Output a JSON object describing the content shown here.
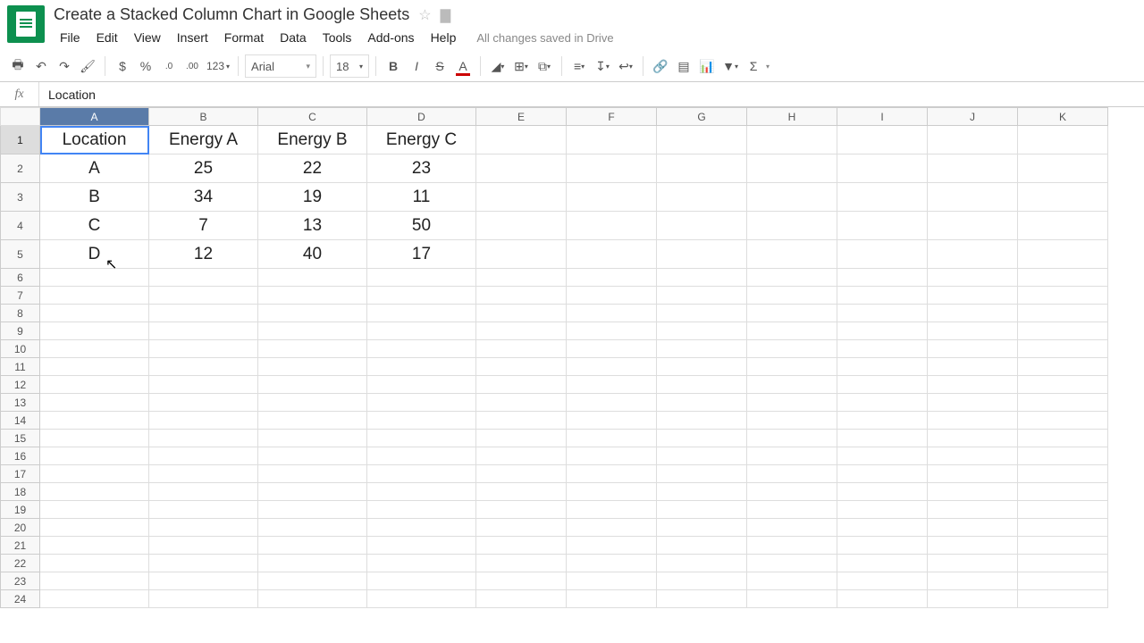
{
  "doc": {
    "title": "Create a Stacked Column Chart in Google Sheets",
    "save_status": "All changes saved in Drive"
  },
  "menu": {
    "file": "File",
    "edit": "Edit",
    "view": "View",
    "insert": "Insert",
    "format": "Format",
    "data": "Data",
    "tools": "Tools",
    "addons": "Add-ons",
    "help": "Help"
  },
  "toolbar": {
    "currency": "$",
    "percent": "%",
    "dec_dec": ".0",
    "inc_dec": ".00",
    "numfmt": "123",
    "font_name": "Arial",
    "font_size": "18",
    "bold": "B",
    "italic": "I",
    "strike": "S",
    "textcolor": "A",
    "sigma": "Σ"
  },
  "formula_bar": {
    "fx": "fx",
    "value": "Location"
  },
  "columns": [
    "A",
    "B",
    "C",
    "D",
    "E",
    "F",
    "G",
    "H",
    "I",
    "J",
    "K"
  ],
  "row_numbers": [
    1,
    2,
    3,
    4,
    5,
    6,
    7,
    8,
    9,
    10,
    11,
    12,
    13,
    14,
    15,
    16,
    17,
    18,
    19,
    20,
    21,
    22,
    23,
    24
  ],
  "selected_cell": "A1",
  "chart_data": {
    "type": "table",
    "headers": [
      "Location",
      "Energy A",
      "Energy B",
      "Energy C"
    ],
    "rows": [
      [
        "A",
        25,
        22,
        23
      ],
      [
        "B",
        34,
        19,
        11
      ],
      [
        "C",
        7,
        13,
        50
      ],
      [
        "D",
        12,
        40,
        17
      ]
    ]
  }
}
